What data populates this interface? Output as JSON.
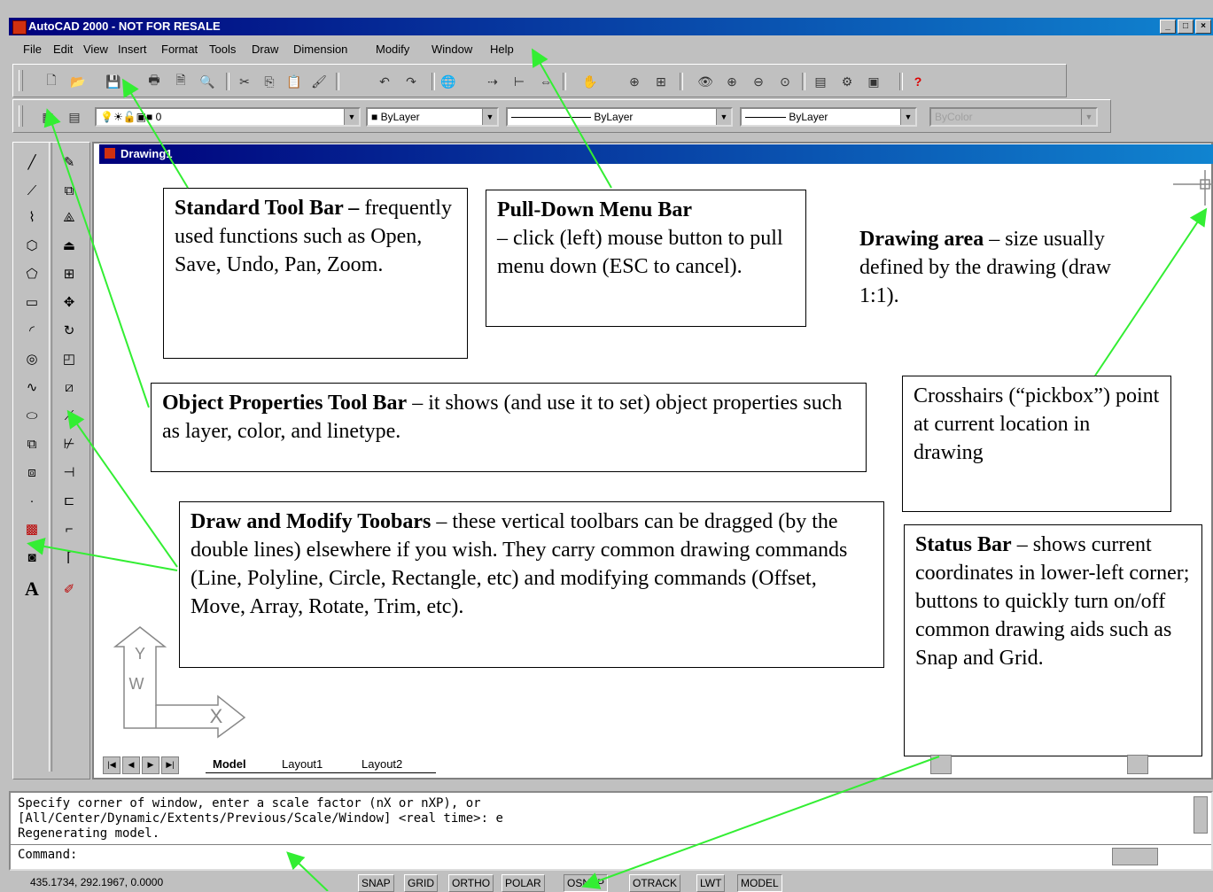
{
  "window": {
    "title": "AutoCAD 2000 - NOT FOR RESALE"
  },
  "menu": [
    "File",
    "Edit",
    "View",
    "Insert",
    "Format",
    "Tools",
    "Draw",
    "Dimension",
    "Modify",
    "Window",
    "Help"
  ],
  "properties": {
    "layer": "0",
    "color": "ByLayer",
    "linetype": "ByLayer",
    "lineweight": "ByLayer",
    "plotstyle": "ByColor"
  },
  "drawing": {
    "title": "Drawing1"
  },
  "ucs": {
    "y": "Y",
    "w": "W",
    "x": "X"
  },
  "tabs": [
    "Model",
    "Layout1",
    "Layout2"
  ],
  "callouts": {
    "standard": {
      "heading": "Standard Tool Bar –",
      "body": "frequently used functions such as Open, Save, Undo, Pan, Zoom."
    },
    "pulldown": {
      "heading": "Pull-Down Menu Bar",
      "body": "– click (left) mouse button to pull menu down (ESC to cancel)."
    },
    "drawing_area": {
      "heading": "Drawing area",
      "body": "– size usually defined by the drawing (draw 1:1)."
    },
    "object_props": {
      "heading": "Object Properties Tool Bar",
      "body": "– it shows (and use it to set) object properties such as layer, color, and linetype."
    },
    "crosshairs": {
      "body": "Crosshairs (“pickbox”) point at current location in drawing"
    },
    "draw_modify": {
      "heading": "Draw and Modify Toobars",
      "body": "– these vertical toolbars can be dragged (by the double lines) elsewhere if you wish. They carry common drawing commands (Line, Polyline, Circle, Rectangle, etc) and modifying commands (Offset, Move, Array, Rotate, Trim, etc)."
    },
    "status": {
      "heading": "Status Bar",
      "body": "– shows current coordinates in lower-left corner; buttons to quickly turn on/off common drawing aids such as Snap and Grid."
    }
  },
  "command": {
    "lines": [
      "Specify corner of window, enter a scale factor (nX or nXP), or",
      "[All/Center/Dynamic/Extents/Previous/Scale/Window] <real time>: e",
      "Regenerating model."
    ],
    "prompt": "Command:"
  },
  "status": {
    "coords": "435.1734, 292.1967, 0.0000",
    "buttons": [
      "SNAP",
      "GRID",
      "ORTHO",
      "POLAR",
      "OSNAP",
      "OTRACK",
      "LWT",
      "MODEL"
    ]
  },
  "colors": {
    "arrow": "#33ee33",
    "title_bar": "#00007b"
  }
}
